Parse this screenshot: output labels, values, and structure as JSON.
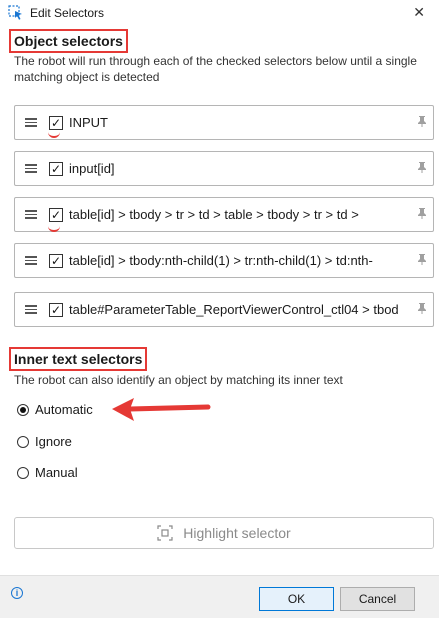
{
  "window": {
    "title": "Edit Selectors"
  },
  "object_selectors": {
    "heading": "Object selectors",
    "description": "The robot will run through each of the checked selectors below until a single matching object is detected",
    "items": [
      {
        "label": "INPUT",
        "checked": true
      },
      {
        "label": "input[id]",
        "checked": true
      },
      {
        "label": "table[id] > tbody > tr > td > table > tbody > tr > td > ",
        "checked": true
      },
      {
        "label": "table[id] > tbody:nth-child(1) > tr:nth-child(1) > td:nth-",
        "checked": true
      },
      {
        "label": "table#ParameterTable_ReportViewerControl_ctl04 > tbod",
        "checked": true
      }
    ]
  },
  "inner_text_selectors": {
    "heading": "Inner text selectors",
    "description": "The robot can also identify an object by matching its inner text",
    "options": [
      {
        "label": "Automatic",
        "checked": true
      },
      {
        "label": "Ignore",
        "checked": false
      },
      {
        "label": "Manual",
        "checked": false
      }
    ]
  },
  "highlight_button": {
    "label": "Highlight selector"
  },
  "footer": {
    "ok_label": "OK",
    "cancel_label": "Cancel",
    "info_symbol": "i"
  },
  "colors": {
    "annotation_red": "#e53935",
    "accent_blue": "#0078d7"
  }
}
